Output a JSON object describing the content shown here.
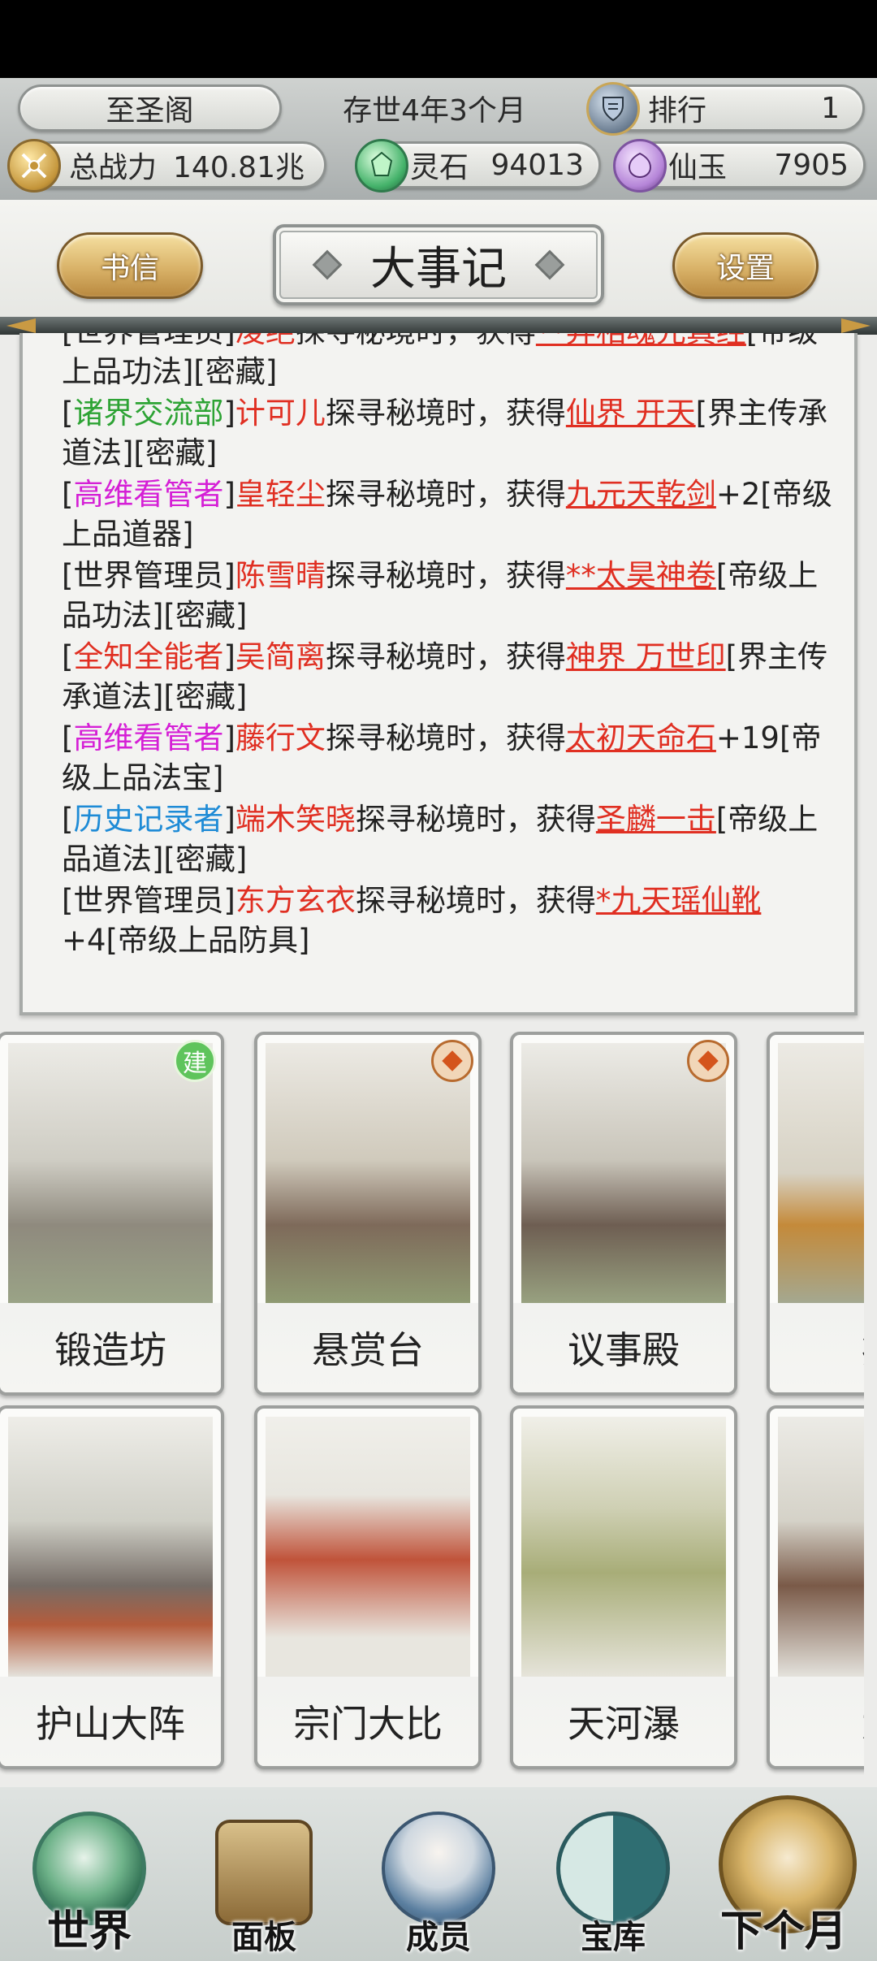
{
  "header": {
    "sect_name": "至圣阁",
    "time": "存世4年3个月",
    "rank_label": "排行",
    "rank_value": "1",
    "power_label": "总战力",
    "power_value": "140.81兆",
    "stone_label": "灵石",
    "stone_value": "94013",
    "jade_label": "仙玉",
    "jade_value": "7905"
  },
  "tabs": {
    "letters": "书信",
    "title": "大事记",
    "settings": "设置"
  },
  "log": [
    {
      "parts": [
        {
          "t": "[世界管理员]",
          "c": ""
        },
        {
          "t": "凌绝",
          "c": "red"
        },
        {
          "t": "探寻秘境时，获得",
          "c": ""
        },
        {
          "t": "**弃相魂元真经",
          "c": "red ul"
        },
        {
          "t": "[帝级上品功法][密藏]",
          "c": ""
        }
      ]
    },
    {
      "parts": [
        {
          "t": "[",
          "c": ""
        },
        {
          "t": "诸界交流部",
          "c": "green"
        },
        {
          "t": "]",
          "c": ""
        },
        {
          "t": "计可儿",
          "c": "red"
        },
        {
          "t": "探寻秘境时，获得",
          "c": ""
        },
        {
          "t": "仙界 开天",
          "c": "red ul"
        },
        {
          "t": "[界主传承道法][密藏]",
          "c": ""
        }
      ]
    },
    {
      "parts": [
        {
          "t": "[",
          "c": ""
        },
        {
          "t": "高维看管者",
          "c": "magenta"
        },
        {
          "t": "]",
          "c": ""
        },
        {
          "t": "皇轻尘",
          "c": "red"
        },
        {
          "t": "探寻秘境时，获得",
          "c": ""
        },
        {
          "t": "九元天乾剑",
          "c": "red ul"
        },
        {
          "t": "+2[帝级上品道器]",
          "c": ""
        }
      ]
    },
    {
      "parts": [
        {
          "t": "[世界管理员]",
          "c": ""
        },
        {
          "t": "陈雪晴",
          "c": "red"
        },
        {
          "t": "探寻秘境时，获得",
          "c": ""
        },
        {
          "t": "**太昊神卷",
          "c": "red ul"
        },
        {
          "t": "[帝级上品功法][密藏]",
          "c": ""
        }
      ]
    },
    {
      "parts": [
        {
          "t": "[",
          "c": ""
        },
        {
          "t": "全知全能者",
          "c": "red"
        },
        {
          "t": "]",
          "c": ""
        },
        {
          "t": "吴简离",
          "c": "red"
        },
        {
          "t": "探寻秘境时，获得",
          "c": ""
        },
        {
          "t": "神界 万世印",
          "c": "red ul"
        },
        {
          "t": "[界主传承道法][密藏]",
          "c": ""
        }
      ]
    },
    {
      "parts": [
        {
          "t": "[",
          "c": ""
        },
        {
          "t": "高维看管者",
          "c": "magenta"
        },
        {
          "t": "]",
          "c": ""
        },
        {
          "t": "藤行文",
          "c": "red"
        },
        {
          "t": "探寻秘境时，获得",
          "c": ""
        },
        {
          "t": "太初天命石",
          "c": "red ul"
        },
        {
          "t": "+19[帝级上品法宝]",
          "c": ""
        }
      ]
    },
    {
      "parts": [
        {
          "t": "[",
          "c": ""
        },
        {
          "t": "历史记录者",
          "c": "blue"
        },
        {
          "t": "]",
          "c": ""
        },
        {
          "t": "端木笑晓",
          "c": "red"
        },
        {
          "t": "探寻秘境时，获得",
          "c": ""
        },
        {
          "t": "圣麟一击",
          "c": "red ul"
        },
        {
          "t": "[帝级上品道法][密藏]",
          "c": ""
        }
      ]
    },
    {
      "parts": [
        {
          "t": "[世界管理员]",
          "c": ""
        },
        {
          "t": "东方玄衣",
          "c": "red"
        },
        {
          "t": "探寻秘境时，获得",
          "c": ""
        },
        {
          "t": "*九天瑶仙靴",
          "c": "red ul"
        },
        {
          "t": "+4[帝级上品防具]",
          "c": ""
        }
      ]
    }
  ],
  "buildings": [
    {
      "label": "锻造坊",
      "badge": "建",
      "icon": "forge-building-icon"
    },
    {
      "label": "悬赏台",
      "badge": "dot",
      "icon": "bounty-hall-icon"
    },
    {
      "label": "议事殿",
      "badge": "dot",
      "icon": "council-palace-icon"
    },
    {
      "label": "痴",
      "badge": "",
      "icon": "partial-building-icon"
    },
    {
      "label": "护山大阵",
      "badge": "",
      "icon": "mountain-formation-icon"
    },
    {
      "label": "宗门大比",
      "badge": "",
      "icon": "sect-banner-icon"
    },
    {
      "label": "天河瀑",
      "badge": "",
      "icon": "waterfall-icon"
    },
    {
      "label": "太",
      "badge": "",
      "icon": "pagoda-icon"
    }
  ],
  "nav": {
    "world": "世界",
    "panel": "面板",
    "members": "成员",
    "treasury": "宝库",
    "next_month": "下个月"
  }
}
